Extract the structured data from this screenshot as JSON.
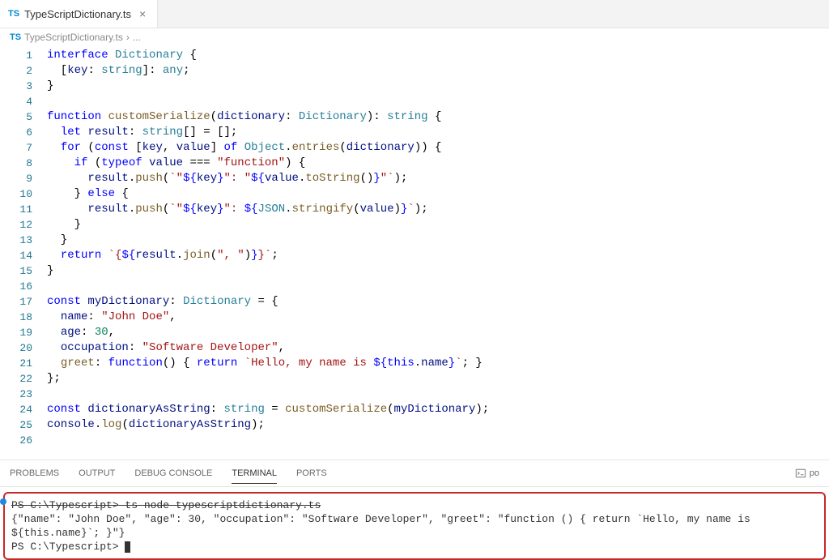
{
  "tab": {
    "badge": "TS",
    "name": "TypeScriptDictionary.ts"
  },
  "breadcrumb": {
    "badge": "TS",
    "file": "TypeScriptDictionary.ts",
    "sep": "›",
    "rest": "..."
  },
  "code": {
    "l1": [
      {
        "c": "k",
        "t": "interface"
      },
      {
        "c": "p",
        "t": " "
      },
      {
        "c": "t",
        "t": "Dictionary"
      },
      {
        "c": "p",
        "t": " {"
      }
    ],
    "l2": [
      {
        "c": "p",
        "t": "  ["
      },
      {
        "c": "v",
        "t": "key"
      },
      {
        "c": "p",
        "t": ": "
      },
      {
        "c": "t",
        "t": "string"
      },
      {
        "c": "p",
        "t": "]: "
      },
      {
        "c": "t",
        "t": "any"
      },
      {
        "c": "p",
        "t": ";"
      }
    ],
    "l3": [
      {
        "c": "p",
        "t": "}"
      }
    ],
    "l4": [],
    "l5": [
      {
        "c": "k",
        "t": "function"
      },
      {
        "c": "p",
        "t": " "
      },
      {
        "c": "fn",
        "t": "customSerialize"
      },
      {
        "c": "p",
        "t": "("
      },
      {
        "c": "v",
        "t": "dictionary"
      },
      {
        "c": "p",
        "t": ": "
      },
      {
        "c": "t",
        "t": "Dictionary"
      },
      {
        "c": "p",
        "t": "): "
      },
      {
        "c": "t",
        "t": "string"
      },
      {
        "c": "p",
        "t": " {"
      }
    ],
    "l6": [
      {
        "c": "p",
        "t": "  "
      },
      {
        "c": "k",
        "t": "let"
      },
      {
        "c": "p",
        "t": " "
      },
      {
        "c": "v",
        "t": "result"
      },
      {
        "c": "p",
        "t": ": "
      },
      {
        "c": "t",
        "t": "string"
      },
      {
        "c": "p",
        "t": "[] = [];"
      }
    ],
    "l7": [
      {
        "c": "p",
        "t": "  "
      },
      {
        "c": "k",
        "t": "for"
      },
      {
        "c": "p",
        "t": " ("
      },
      {
        "c": "k",
        "t": "const"
      },
      {
        "c": "p",
        "t": " ["
      },
      {
        "c": "v",
        "t": "key"
      },
      {
        "c": "p",
        "t": ", "
      },
      {
        "c": "v",
        "t": "value"
      },
      {
        "c": "p",
        "t": "] "
      },
      {
        "c": "k",
        "t": "of"
      },
      {
        "c": "p",
        "t": " "
      },
      {
        "c": "t",
        "t": "Object"
      },
      {
        "c": "p",
        "t": "."
      },
      {
        "c": "fn",
        "t": "entries"
      },
      {
        "c": "p",
        "t": "("
      },
      {
        "c": "v",
        "t": "dictionary"
      },
      {
        "c": "p",
        "t": ")) {"
      }
    ],
    "l8": [
      {
        "c": "p",
        "t": "    "
      },
      {
        "c": "k",
        "t": "if"
      },
      {
        "c": "p",
        "t": " ("
      },
      {
        "c": "k",
        "t": "typeof"
      },
      {
        "c": "p",
        "t": " "
      },
      {
        "c": "v",
        "t": "value"
      },
      {
        "c": "p",
        "t": " === "
      },
      {
        "c": "s",
        "t": "\"function\""
      },
      {
        "c": "p",
        "t": ") {"
      }
    ],
    "l9": [
      {
        "c": "p",
        "t": "      "
      },
      {
        "c": "v",
        "t": "result"
      },
      {
        "c": "p",
        "t": "."
      },
      {
        "c": "fn",
        "t": "push"
      },
      {
        "c": "p",
        "t": "("
      },
      {
        "c": "tmpl",
        "t": "`\""
      },
      {
        "c": "k",
        "t": "${"
      },
      {
        "c": "tmplv",
        "t": "key"
      },
      {
        "c": "k",
        "t": "}"
      },
      {
        "c": "tmpl",
        "t": "\": \""
      },
      {
        "c": "k",
        "t": "${"
      },
      {
        "c": "tmplv",
        "t": "value"
      },
      {
        "c": "p",
        "t": "."
      },
      {
        "c": "fn",
        "t": "toString"
      },
      {
        "c": "p",
        "t": "()"
      },
      {
        "c": "k",
        "t": "}"
      },
      {
        "c": "tmpl",
        "t": "\"`"
      },
      {
        "c": "p",
        "t": ");"
      }
    ],
    "l10": [
      {
        "c": "p",
        "t": "    } "
      },
      {
        "c": "k",
        "t": "else"
      },
      {
        "c": "p",
        "t": " {"
      }
    ],
    "l11": [
      {
        "c": "p",
        "t": "      "
      },
      {
        "c": "v",
        "t": "result"
      },
      {
        "c": "p",
        "t": "."
      },
      {
        "c": "fn",
        "t": "push"
      },
      {
        "c": "p",
        "t": "("
      },
      {
        "c": "tmpl",
        "t": "`\""
      },
      {
        "c": "k",
        "t": "${"
      },
      {
        "c": "tmplv",
        "t": "key"
      },
      {
        "c": "k",
        "t": "}"
      },
      {
        "c": "tmpl",
        "t": "\": "
      },
      {
        "c": "k",
        "t": "${"
      },
      {
        "c": "t",
        "t": "JSON"
      },
      {
        "c": "p",
        "t": "."
      },
      {
        "c": "fn",
        "t": "stringify"
      },
      {
        "c": "p",
        "t": "("
      },
      {
        "c": "v",
        "t": "value"
      },
      {
        "c": "p",
        "t": ")"
      },
      {
        "c": "k",
        "t": "}"
      },
      {
        "c": "tmpl",
        "t": "`"
      },
      {
        "c": "p",
        "t": ");"
      }
    ],
    "l12": [
      {
        "c": "p",
        "t": "    }"
      }
    ],
    "l13": [
      {
        "c": "p",
        "t": "  }"
      }
    ],
    "l14": [
      {
        "c": "p",
        "t": "  "
      },
      {
        "c": "k",
        "t": "return"
      },
      {
        "c": "p",
        "t": " "
      },
      {
        "c": "tmpl",
        "t": "`{"
      },
      {
        "c": "k",
        "t": "${"
      },
      {
        "c": "v",
        "t": "result"
      },
      {
        "c": "p",
        "t": "."
      },
      {
        "c": "fn",
        "t": "join"
      },
      {
        "c": "p",
        "t": "("
      },
      {
        "c": "s",
        "t": "\", \""
      },
      {
        "c": "p",
        "t": ")"
      },
      {
        "c": "k",
        "t": "}"
      },
      {
        "c": "tmpl",
        "t": "}`"
      },
      {
        "c": "p",
        "t": ";"
      }
    ],
    "l15": [
      {
        "c": "p",
        "t": "}"
      }
    ],
    "l16": [],
    "l17": [
      {
        "c": "k",
        "t": "const"
      },
      {
        "c": "p",
        "t": " "
      },
      {
        "c": "v",
        "t": "myDictionary"
      },
      {
        "c": "p",
        "t": ": "
      },
      {
        "c": "t",
        "t": "Dictionary"
      },
      {
        "c": "p",
        "t": " = {"
      }
    ],
    "l18": [
      {
        "c": "p",
        "t": "  "
      },
      {
        "c": "v",
        "t": "name"
      },
      {
        "c": "p",
        "t": ": "
      },
      {
        "c": "s",
        "t": "\"John Doe\""
      },
      {
        "c": "p",
        "t": ","
      }
    ],
    "l19": [
      {
        "c": "p",
        "t": "  "
      },
      {
        "c": "v",
        "t": "age"
      },
      {
        "c": "p",
        "t": ": "
      },
      {
        "c": "n",
        "t": "30"
      },
      {
        "c": "p",
        "t": ","
      }
    ],
    "l20": [
      {
        "c": "p",
        "t": "  "
      },
      {
        "c": "v",
        "t": "occupation"
      },
      {
        "c": "p",
        "t": ": "
      },
      {
        "c": "s",
        "t": "\"Software Developer\""
      },
      {
        "c": "p",
        "t": ","
      }
    ],
    "l21": [
      {
        "c": "p",
        "t": "  "
      },
      {
        "c": "fn",
        "t": "greet"
      },
      {
        "c": "p",
        "t": ": "
      },
      {
        "c": "k",
        "t": "function"
      },
      {
        "c": "p",
        "t": "() { "
      },
      {
        "c": "k",
        "t": "return"
      },
      {
        "c": "p",
        "t": " "
      },
      {
        "c": "tmpl",
        "t": "`Hello, my name is "
      },
      {
        "c": "k",
        "t": "${"
      },
      {
        "c": "k",
        "t": "this"
      },
      {
        "c": "p",
        "t": "."
      },
      {
        "c": "v",
        "t": "name"
      },
      {
        "c": "k",
        "t": "}"
      },
      {
        "c": "tmpl",
        "t": "`"
      },
      {
        "c": "p",
        "t": "; }"
      }
    ],
    "l22": [
      {
        "c": "p",
        "t": "};"
      }
    ],
    "l23": [],
    "l24": [
      {
        "c": "k",
        "t": "const"
      },
      {
        "c": "p",
        "t": " "
      },
      {
        "c": "v",
        "t": "dictionaryAsString"
      },
      {
        "c": "p",
        "t": ": "
      },
      {
        "c": "t",
        "t": "string"
      },
      {
        "c": "p",
        "t": " = "
      },
      {
        "c": "fn",
        "t": "customSerialize"
      },
      {
        "c": "p",
        "t": "("
      },
      {
        "c": "v",
        "t": "myDictionary"
      },
      {
        "c": "p",
        "t": ");"
      }
    ],
    "l25": [
      {
        "c": "v",
        "t": "console"
      },
      {
        "c": "p",
        "t": "."
      },
      {
        "c": "fn",
        "t": "log"
      },
      {
        "c": "p",
        "t": "("
      },
      {
        "c": "v",
        "t": "dictionaryAsString"
      },
      {
        "c": "p",
        "t": ");"
      }
    ],
    "l26": []
  },
  "panel": {
    "problems": "PROBLEMS",
    "output": "OUTPUT",
    "debug": "DEBUG CONSOLE",
    "terminal": "TERMINAL",
    "ports": "PORTS",
    "shell": "po"
  },
  "terminal": {
    "line1": "PS C:\\Typescript> ts-node typescriptdictionary.ts",
    "line2": "{\"name\": \"John Doe\", \"age\": 30, \"occupation\": \"Software Developer\", \"greet\": \"function () { return `Hello, my name is ${this.name}`; }\"}",
    "line3": "PS C:\\Typescript> "
  },
  "lines": 26
}
